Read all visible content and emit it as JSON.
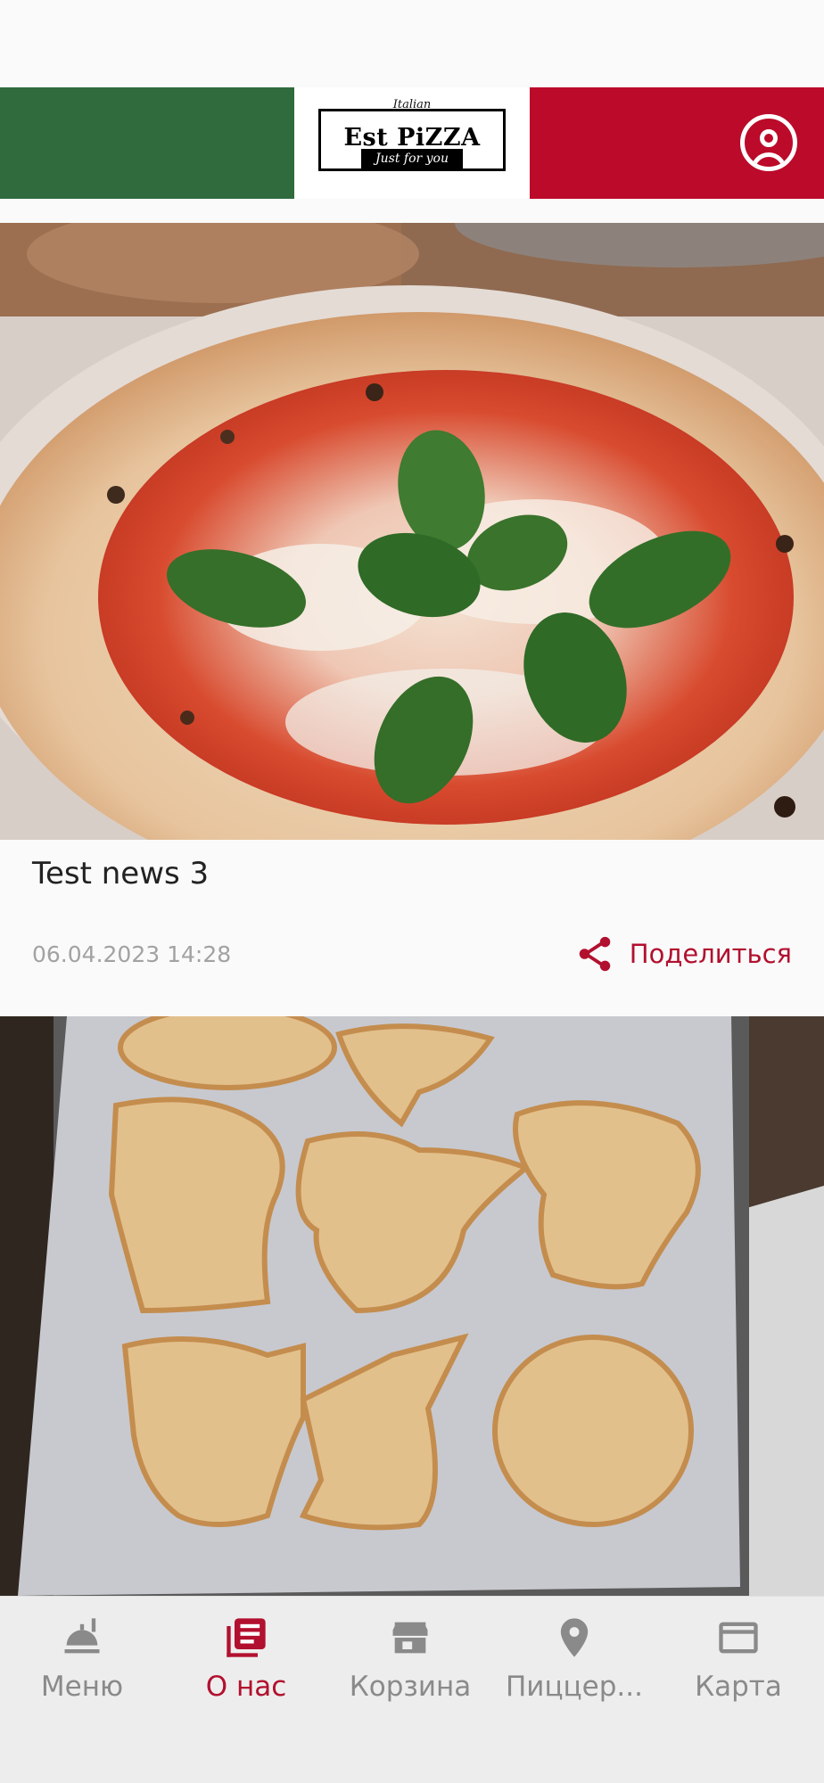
{
  "header": {
    "logo_top": "Italian",
    "logo_main": "Est PiZZA",
    "logo_bottom": "Just for you",
    "colors": {
      "green": "#2f6b3d",
      "white": "#ffffff",
      "red": "#bc0a2a"
    },
    "profile_icon": "account-circle-icon"
  },
  "feed": {
    "items": [
      {
        "title": "Test news 3",
        "date": "06.04.2023 14:28",
        "share_label": "Поделиться",
        "image": "pizza-margherita-photo"
      },
      {
        "image": "halloween-cookies-photo"
      }
    ]
  },
  "bottom_nav": {
    "items": [
      {
        "label": "Меню",
        "icon": "food-tray-icon",
        "active": false
      },
      {
        "label": "О нас",
        "icon": "newspaper-icon",
        "active": true
      },
      {
        "label": "Корзина",
        "icon": "store-icon",
        "active": false
      },
      {
        "label": "Пиццер...",
        "icon": "location-pin-icon",
        "active": false
      },
      {
        "label": "Карта",
        "icon": "credit-card-icon",
        "active": false
      }
    ],
    "active_color": "#b2102f",
    "inactive_color": "#8a8a8a"
  }
}
